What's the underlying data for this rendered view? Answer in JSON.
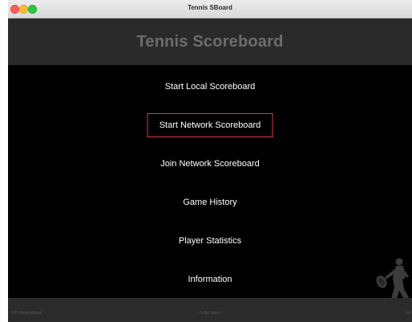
{
  "window": {
    "title": "Tennis SBoard"
  },
  "header": {
    "title": "Tennis Scoreboard"
  },
  "menu": {
    "items": [
      {
        "label": "Start Local Scoreboard",
        "selected": false
      },
      {
        "label": "Start Network Scoreboard",
        "selected": true
      },
      {
        "label": "Join Network Scoreboard",
        "selected": false
      },
      {
        "label": "Game History",
        "selected": false
      },
      {
        "label": "Player Statistics",
        "selected": false
      },
      {
        "label": "Information",
        "selected": false
      }
    ]
  },
  "footer": {
    "left": "NPL International",
    "center": "Ts bik spsnd",
    "right": "vxt"
  },
  "colors": {
    "background": "#000000",
    "header": "#2a2a2a",
    "title_text": "#6d6d6d",
    "menu_text": "#ffffff",
    "selection_border": "#e03b3b",
    "footer": "#2b2b2b"
  },
  "icons": {
    "decoration": "tennis-player-silhouette-icon"
  }
}
